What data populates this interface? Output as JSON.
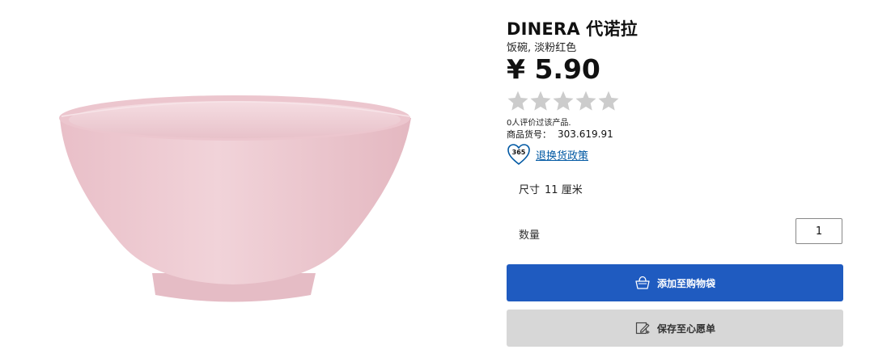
{
  "product": {
    "name": "DINERA 代诺拉",
    "description": "饭碗, 淡粉红色",
    "price": "¥ 5.90",
    "rating": {
      "stars_total": 5,
      "stars_filled": 0,
      "review_text": "0人评价过该产品."
    },
    "article_label": "商品货号：",
    "article_number": "303.619.91",
    "return_policy": {
      "badge": "365",
      "link_text": "退换货政策"
    },
    "size_label": "尺寸",
    "size_value": "11 厘米"
  },
  "quantity": {
    "label": "数量",
    "value": "1"
  },
  "buttons": {
    "add_to_cart": "添加至购物袋",
    "save_wishlist": "保存至心愿单"
  },
  "colors": {
    "primary_button": "#1f5bc0",
    "secondary_button": "#d7d7d7",
    "link": "#0058a3",
    "star_empty": "#cccccc",
    "bowl": "#eec9d0"
  },
  "icons": [
    "shopping-bag-icon",
    "wishlist-pencil-icon",
    "return-policy-heart-icon",
    "star-icon"
  ]
}
